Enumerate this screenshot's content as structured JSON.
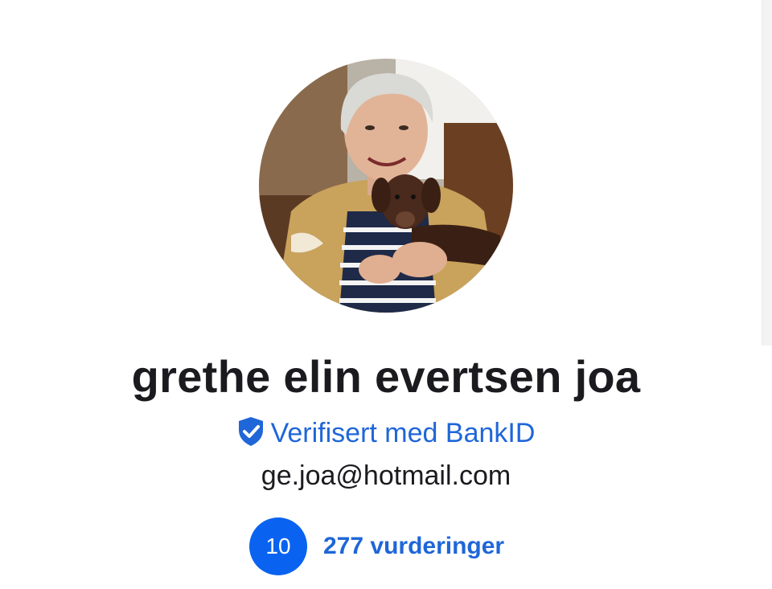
{
  "profile": {
    "name": "grethe elin evertsen joa",
    "verified_label": "Verifisert med BankID",
    "email": "ge.joa@hotmail.com",
    "rating_score": "10",
    "reviews_label": "277 vurderinger"
  },
  "icons": {
    "verified": "shield-check-icon"
  },
  "colors": {
    "accent": "#1f66d8",
    "badge": "#0a63f0",
    "text": "#1b1b1f"
  }
}
